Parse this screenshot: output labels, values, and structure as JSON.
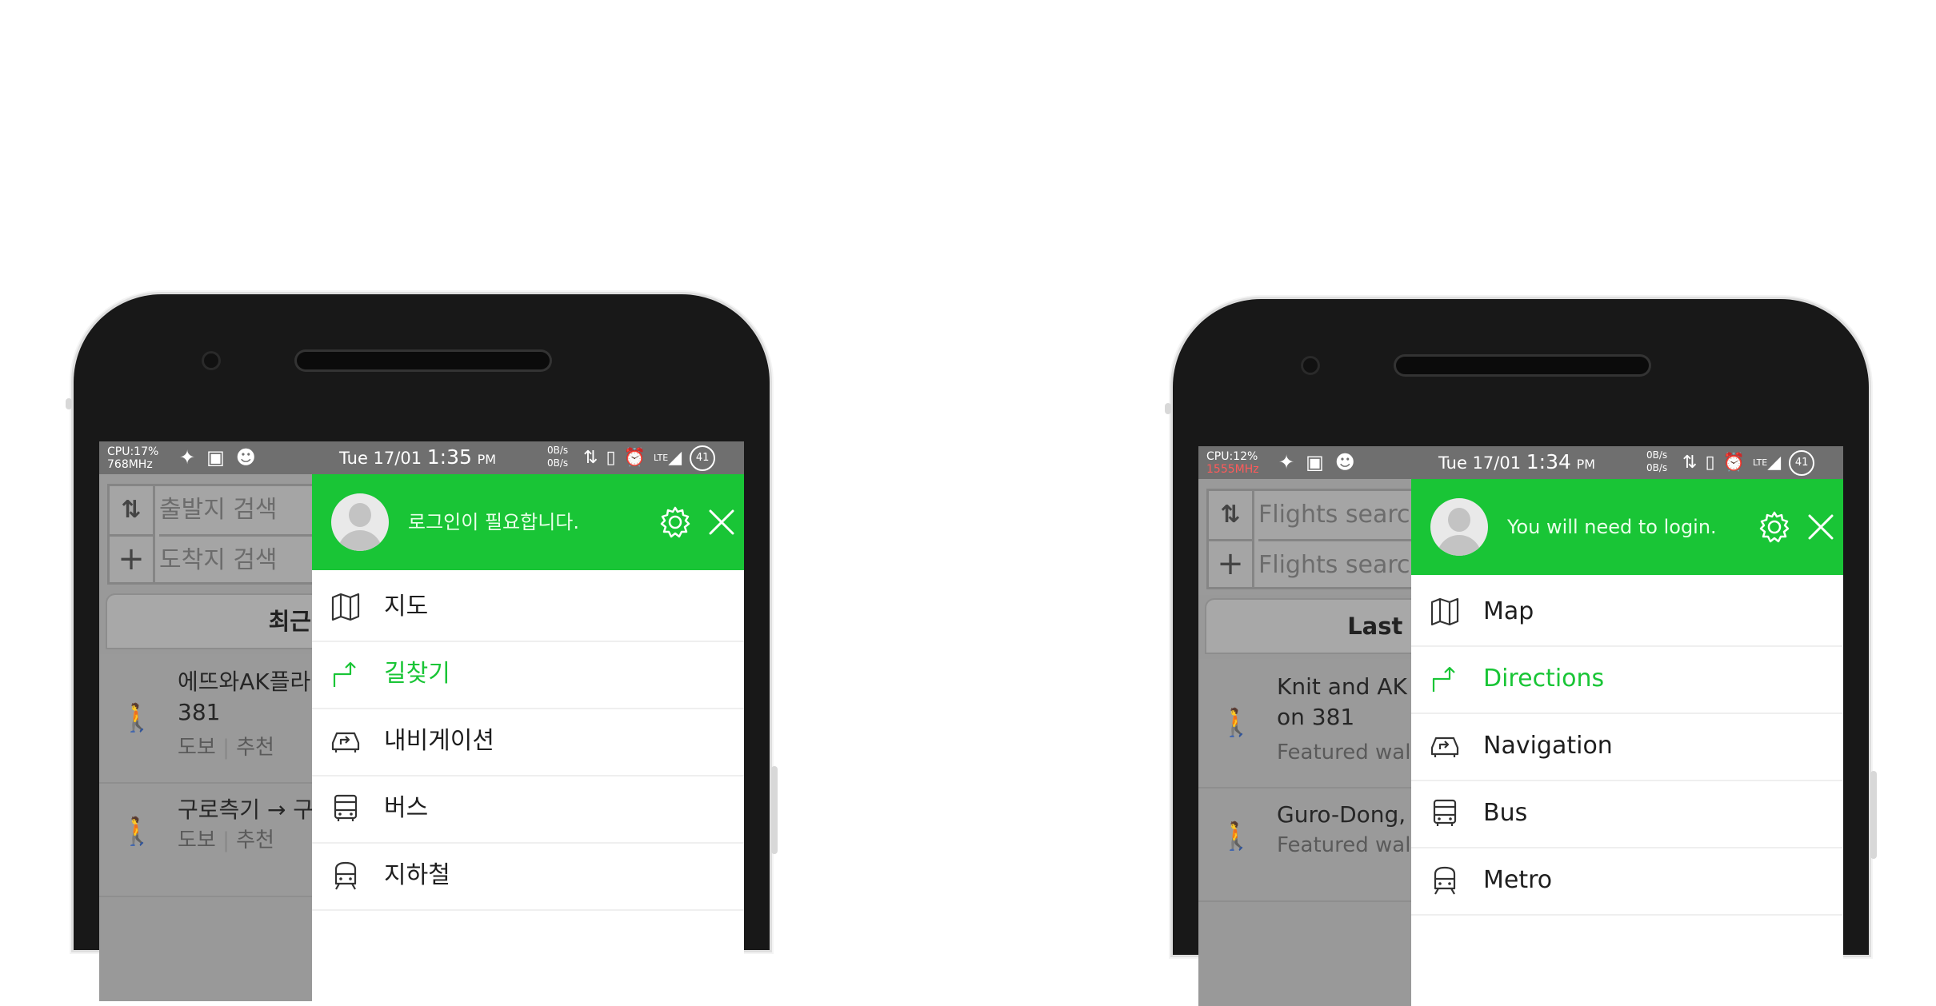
{
  "colors": {
    "accent": "#19c536",
    "status_bar": "#6f6f6f",
    "scrim": "#999999"
  },
  "phones": [
    {
      "status": {
        "cpu": "CPU:17%",
        "mhz": "768MHz",
        "date": "Tue 17/01",
        "time": "1:35",
        "ampm": "PM",
        "speed_up": "0B/s",
        "speed_down": "0B/s",
        "lte": "LTE",
        "battery": "41"
      },
      "search": {
        "origin_placeholder": "출발지 검색",
        "destination_placeholder": "도착지 검색"
      },
      "tab_recent": "최근이용",
      "list": [
        {
          "title": "에뜨와AK플라\n 381",
          "mode": "도보",
          "tag": "추천"
        },
        {
          "title": "구로측기 → 구",
          "mode": "도보",
          "tag": "추천"
        }
      ],
      "drawer": {
        "login_text": "로그인이 필요합니다.",
        "menu": [
          {
            "label": "지도",
            "icon": "map-icon"
          },
          {
            "label": "길찾기",
            "icon": "directions-icon"
          },
          {
            "label": "내비게이션",
            "icon": "navigation-car-icon"
          },
          {
            "label": "버스",
            "icon": "bus-icon"
          },
          {
            "label": "지하철",
            "icon": "metro-icon"
          }
        ]
      }
    },
    {
      "status": {
        "cpu": "CPU:12%",
        "mhz": "1555MHz",
        "date": "Tue 17/01",
        "time": "1:34",
        "ampm": "PM",
        "speed_up": "0B/s",
        "speed_down": "0B/s",
        "lte": "LTE",
        "battery": "41"
      },
      "search": {
        "origin_placeholder": "Flights searc",
        "destination_placeholder": "Flights searc"
      },
      "tab_recent": "Last used",
      "list": [
        {
          "title": "Knit and AK\non 381",
          "sub": "Featured walk"
        },
        {
          "title": "Guro-Dong, C",
          "sub": "Featured walk"
        }
      ],
      "drawer": {
        "login_text": "You will need to login.",
        "menu": [
          {
            "label": "Map",
            "icon": "map-icon"
          },
          {
            "label": "Directions",
            "icon": "directions-icon"
          },
          {
            "label": "Navigation",
            "icon": "navigation-car-icon"
          },
          {
            "label": "Bus",
            "icon": "bus-icon"
          },
          {
            "label": "Metro",
            "icon": "metro-icon"
          }
        ]
      }
    }
  ],
  "active_menu_index": 1
}
